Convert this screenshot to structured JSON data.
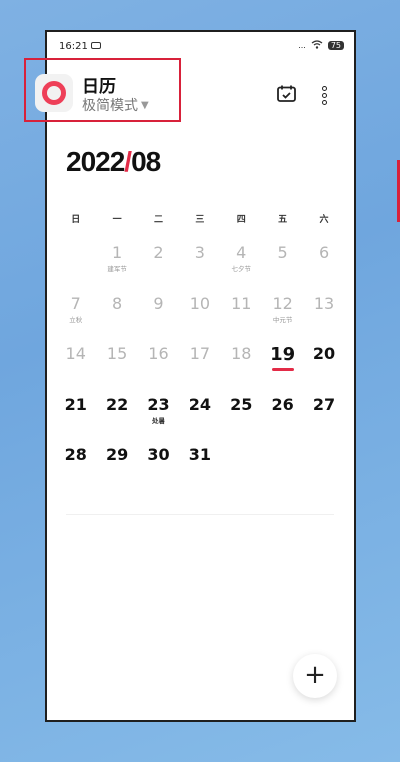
{
  "status_bar": {
    "time": "16:21",
    "battery": "75",
    "signal": "..."
  },
  "app": {
    "title": "日历",
    "mode": "极简模式",
    "mode_caret": "▼"
  },
  "calendar": {
    "year_month_year": "2022",
    "year_month_sep": "/",
    "year_month_month": "08",
    "weekdays": [
      "日",
      "一",
      "二",
      "三",
      "四",
      "五",
      "六"
    ],
    "weeks": [
      [
        {
          "d": "",
          "l": "",
          "s": "empty"
        },
        {
          "d": "1",
          "l": "建军节",
          "s": "past"
        },
        {
          "d": "2",
          "l": "",
          "s": "past"
        },
        {
          "d": "3",
          "l": "",
          "s": "past"
        },
        {
          "d": "4",
          "l": "七夕节",
          "s": "past"
        },
        {
          "d": "5",
          "l": "",
          "s": "past"
        },
        {
          "d": "6",
          "l": "",
          "s": "past"
        }
      ],
      [
        {
          "d": "7",
          "l": "立秋",
          "s": "past"
        },
        {
          "d": "8",
          "l": "",
          "s": "past"
        },
        {
          "d": "9",
          "l": "",
          "s": "past"
        },
        {
          "d": "10",
          "l": "",
          "s": "past"
        },
        {
          "d": "11",
          "l": "",
          "s": "past"
        },
        {
          "d": "12",
          "l": "中元节",
          "s": "past"
        },
        {
          "d": "13",
          "l": "",
          "s": "past"
        }
      ],
      [
        {
          "d": "14",
          "l": "",
          "s": "past"
        },
        {
          "d": "15",
          "l": "",
          "s": "past"
        },
        {
          "d": "16",
          "l": "",
          "s": "past"
        },
        {
          "d": "17",
          "l": "",
          "s": "past"
        },
        {
          "d": "18",
          "l": "",
          "s": "past"
        },
        {
          "d": "19",
          "l": "",
          "s": "today"
        },
        {
          "d": "20",
          "l": "",
          "s": "future"
        }
      ],
      [
        {
          "d": "21",
          "l": "",
          "s": "future"
        },
        {
          "d": "22",
          "l": "",
          "s": "future"
        },
        {
          "d": "23",
          "l": "处暑",
          "s": "future"
        },
        {
          "d": "24",
          "l": "",
          "s": "future"
        },
        {
          "d": "25",
          "l": "",
          "s": "future"
        },
        {
          "d": "26",
          "l": "",
          "s": "future"
        },
        {
          "d": "27",
          "l": "",
          "s": "future"
        }
      ],
      [
        {
          "d": "28",
          "l": "",
          "s": "future"
        },
        {
          "d": "29",
          "l": "",
          "s": "future"
        },
        {
          "d": "30",
          "l": "",
          "s": "future"
        },
        {
          "d": "31",
          "l": "",
          "s": "future"
        },
        {
          "d": "",
          "l": "",
          "s": "empty"
        },
        {
          "d": "",
          "l": "",
          "s": "empty"
        },
        {
          "d": "",
          "l": "",
          "s": "empty"
        }
      ]
    ]
  },
  "fab": {
    "label": "+"
  },
  "colors": {
    "accent": "#e32b47",
    "highlight_box": "#d8213a"
  },
  "icons": {
    "today": "calendar-check-icon",
    "more": "more-vertical-icon",
    "app": "app-ring-icon"
  }
}
